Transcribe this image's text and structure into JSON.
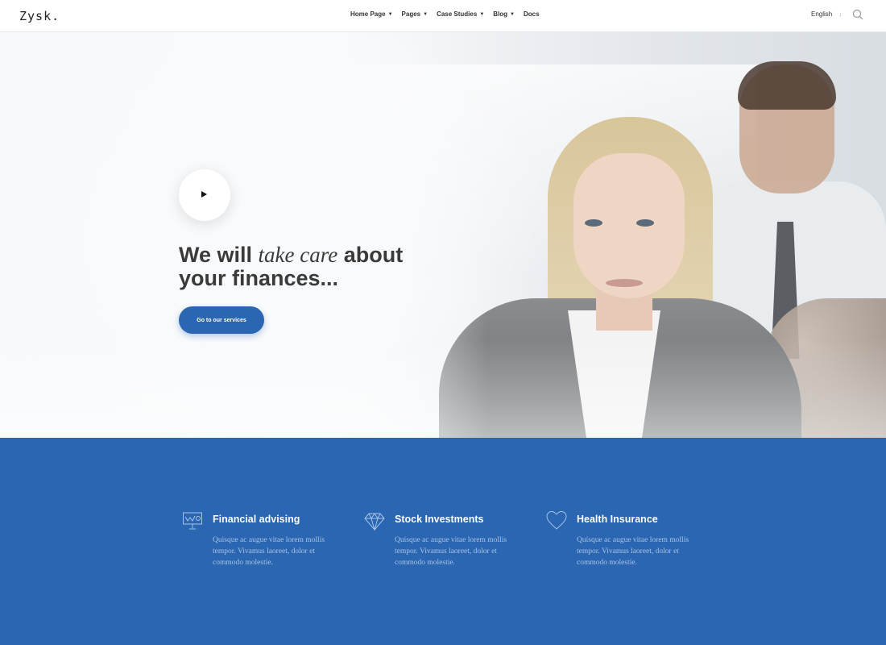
{
  "header": {
    "logo": "Zysk.",
    "nav": [
      {
        "label": "Home Page",
        "has_dropdown": true
      },
      {
        "label": "Pages",
        "has_dropdown": true
      },
      {
        "label": "Case Studies",
        "has_dropdown": true
      },
      {
        "label": "Blog",
        "has_dropdown": true
      },
      {
        "label": "Docs",
        "has_dropdown": false
      }
    ],
    "language": "English",
    "search_icon": "search-icon"
  },
  "hero": {
    "headline_part1": "We will",
    "headline_italic": "take care",
    "headline_part2": "about",
    "headline_line2": "your finances...",
    "cta_label": "Go to our services",
    "play_icon": "play-icon"
  },
  "services": [
    {
      "icon": "presentation-chart-icon",
      "title": "Financial advising",
      "desc": "Quisque ac augue vitae lorem mollis tempor. Vivamus laoreet, dolor et commodo molestie."
    },
    {
      "icon": "diamond-icon",
      "title": "Stock Investments",
      "desc": "Quisque ac augue vitae lorem mollis tempor. Vivamus laoreet, dolor et commodo molestie."
    },
    {
      "icon": "heart-icon",
      "title": "Health Insurance",
      "desc": "Quisque ac augue vitae lorem mollis tempor. Vivamus laoreet, dolor et commodo molestie."
    }
  ],
  "colors": {
    "accent": "#2a66b1",
    "service_text": "#a9c3e6",
    "heading": "#3a3a3a"
  }
}
